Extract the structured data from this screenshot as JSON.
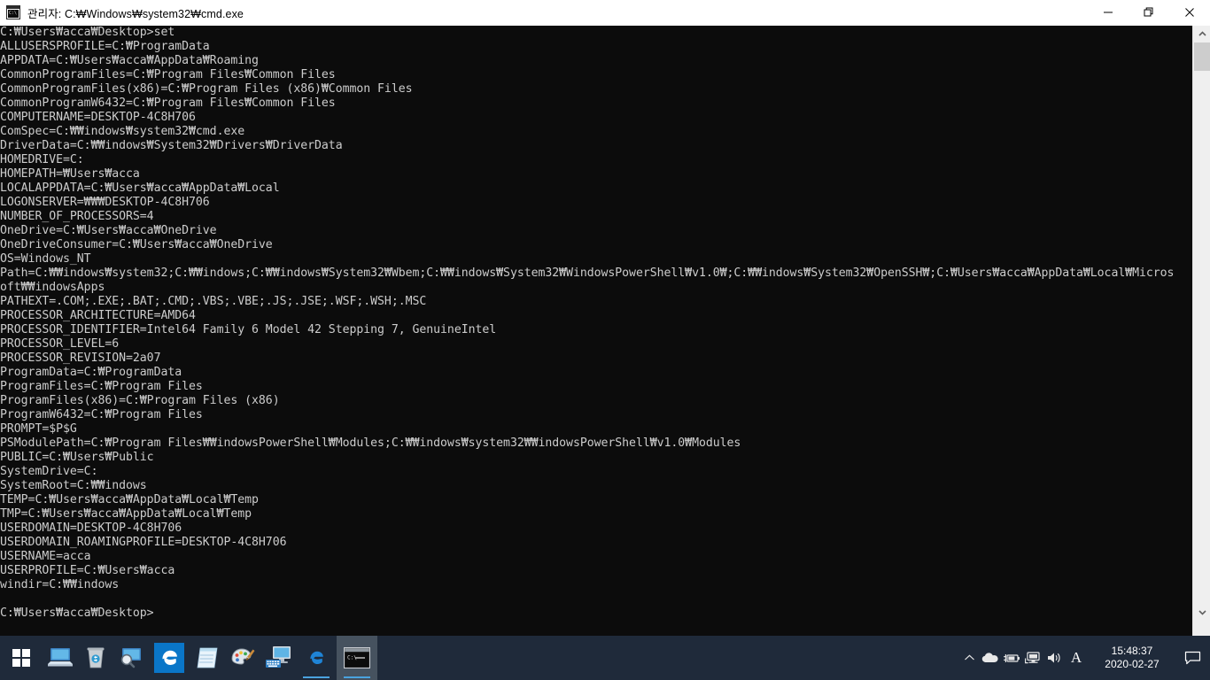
{
  "window": {
    "title": "관리자: C:₩Windows₩system32₩cmd.exe",
    "icon_label": "C:\\",
    "icon_name": "cmd-icon",
    "minimize_label": "─",
    "maximize_label": "❐",
    "close_label": "✕",
    "bg_color": "#0c0c0c",
    "text_color": "#cccccc",
    "titlebar_color": "#ffffff"
  },
  "console": {
    "command": "set",
    "prompt": "C:₩Users₩acca₩Desktop>",
    "lines": [
      "C:₩Users₩acca₩Desktop>set",
      "ALLUSERSPROFILE=C:₩ProgramData",
      "APPDATA=C:₩Users₩acca₩AppData₩Roaming",
      "CommonProgramFiles=C:₩Program Files₩Common Files",
      "CommonProgramFiles(x86)=C:₩Program Files (x86)₩Common Files",
      "CommonProgramW6432=C:₩Program Files₩Common Files",
      "COMPUTERNAME=DESKTOP-4C8H706",
      "ComSpec=C:₩₩indows₩system32₩cmd.exe",
      "DriverData=C:₩₩indows₩System32₩Drivers₩DriverData",
      "HOMEDRIVE=C:",
      "HOMEPATH=₩Users₩acca",
      "LOCALAPPDATA=C:₩Users₩acca₩AppData₩Local",
      "LOGONSERVER=₩₩₩DESKTOP-4C8H706",
      "NUMBER_OF_PROCESSORS=4",
      "OneDrive=C:₩Users₩acca₩OneDrive",
      "OneDriveConsumer=C:₩Users₩acca₩OneDrive",
      "OS=Windows_NT",
      "Path=C:₩₩indows₩system32;C:₩₩indows;C:₩₩indows₩System32₩Wbem;C:₩₩indows₩System32₩WindowsPowerShell₩v1.0₩;C:₩₩indows₩System32₩OpenSSH₩;C:₩Users₩acca₩AppData₩Local₩Micros",
      "oft₩₩indowsApps",
      "PATHEXT=.COM;.EXE;.BAT;.CMD;.VBS;.VBE;.JS;.JSE;.WSF;.WSH;.MSC",
      "PROCESSOR_ARCHITECTURE=AMD64",
      "PROCESSOR_IDENTIFIER=Intel64 Family 6 Model 42 Stepping 7, GenuineIntel",
      "PROCESSOR_LEVEL=6",
      "PROCESSOR_REVISION=2a07",
      "ProgramData=C:₩ProgramData",
      "ProgramFiles=C:₩Program Files",
      "ProgramFiles(x86)=C:₩Program Files (x86)",
      "ProgramW6432=C:₩Program Files",
      "PROMPT=$P$G",
      "PSModulePath=C:₩Program Files₩₩indowsPowerShell₩Modules;C:₩₩indows₩system32₩₩indowsPowerShell₩v1.0₩Modules",
      "PUBLIC=C:₩Users₩Public",
      "SystemDrive=C:",
      "SystemRoot=C:₩₩indows",
      "TEMP=C:₩Users₩acca₩AppData₩Local₩Temp",
      "TMP=C:₩Users₩acca₩AppData₩Local₩Temp",
      "USERDOMAIN=DESKTOP-4C8H706",
      "USERDOMAIN_ROAMINGPROFILE=DESKTOP-4C8H706",
      "USERNAME=acca",
      "USERPROFILE=C:₩Users₩acca",
      "windir=C:₩₩indows",
      "",
      "C:₩Users₩acca₩Desktop>"
    ]
  },
  "scrollbar": {
    "up_arrow": "▲",
    "down_arrow": "▼"
  },
  "taskbar": {
    "bg_color": "#1f2a3a",
    "accent_color": "#4aa3df",
    "start": {
      "name": "start-button",
      "label": "Start"
    },
    "pinned": [
      {
        "name": "this-pc-icon",
        "label": "This PC"
      },
      {
        "name": "recycle-bin-icon",
        "label": "Recycle Bin"
      },
      {
        "name": "search-display-icon",
        "label": "Search"
      },
      {
        "name": "edge-browser-icon",
        "label": "Microsoft Edge"
      },
      {
        "name": "notepad-icon",
        "label": "Notepad"
      },
      {
        "name": "paint-icon",
        "label": "Paint"
      },
      {
        "name": "remote-desktop-icon",
        "label": "Remote Desktop"
      }
    ],
    "running": [
      {
        "name": "taskbar-edge-window",
        "label": "Microsoft Edge",
        "active": false
      },
      {
        "name": "taskbar-cmd-window",
        "label": "cmd.exe",
        "active": true
      }
    ],
    "tray": {
      "show_hidden": "︿",
      "icons": [
        {
          "name": "onedrive-cloud-icon",
          "label": "OneDrive"
        },
        {
          "name": "battery-icon",
          "label": "Battery"
        },
        {
          "name": "network-icon",
          "label": "Network"
        },
        {
          "name": "volume-icon",
          "label": "Volume"
        }
      ],
      "ime_indicator": "A",
      "clock_time": "15:48:37",
      "clock_date": "2020-02-27",
      "action_center": "Notifications"
    }
  }
}
